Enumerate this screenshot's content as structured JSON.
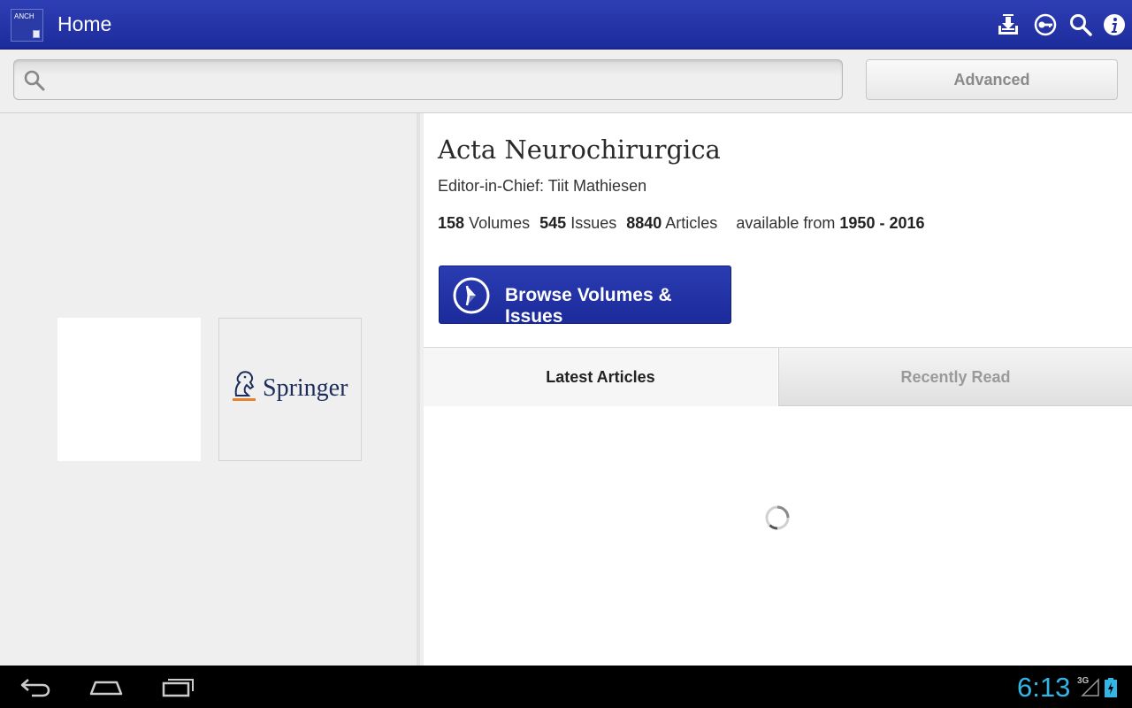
{
  "actionbar": {
    "app_icon_abbr": "ANCH",
    "title": "Home",
    "icons": [
      "download-icon",
      "key-icon",
      "search-icon",
      "info-icon"
    ]
  },
  "search": {
    "value": "",
    "placeholder": "",
    "advanced_label": "Advanced"
  },
  "covers": {
    "publisher": "Springer"
  },
  "journal": {
    "title": "Acta Neurochirurgica",
    "editor": "Editor-in-Chief: Tiit Mathiesen",
    "volumes_count": "158",
    "volumes_label": "Volumes",
    "issues_count": "545",
    "issues_label": "Issues",
    "articles_count": "8840",
    "articles_label": "Articles",
    "available_label": "available from",
    "year_range": "1950 - 2016"
  },
  "browse_button": {
    "label": "Browse Volumes & Issues"
  },
  "tabs": [
    {
      "label": "Latest Articles",
      "selected": true
    },
    {
      "label": "Recently Read",
      "selected": false
    }
  ],
  "statusbar": {
    "time": "6:13",
    "network": "3G"
  },
  "colors": {
    "accent": "#1f2ea0",
    "clock": "#33b5e5"
  }
}
